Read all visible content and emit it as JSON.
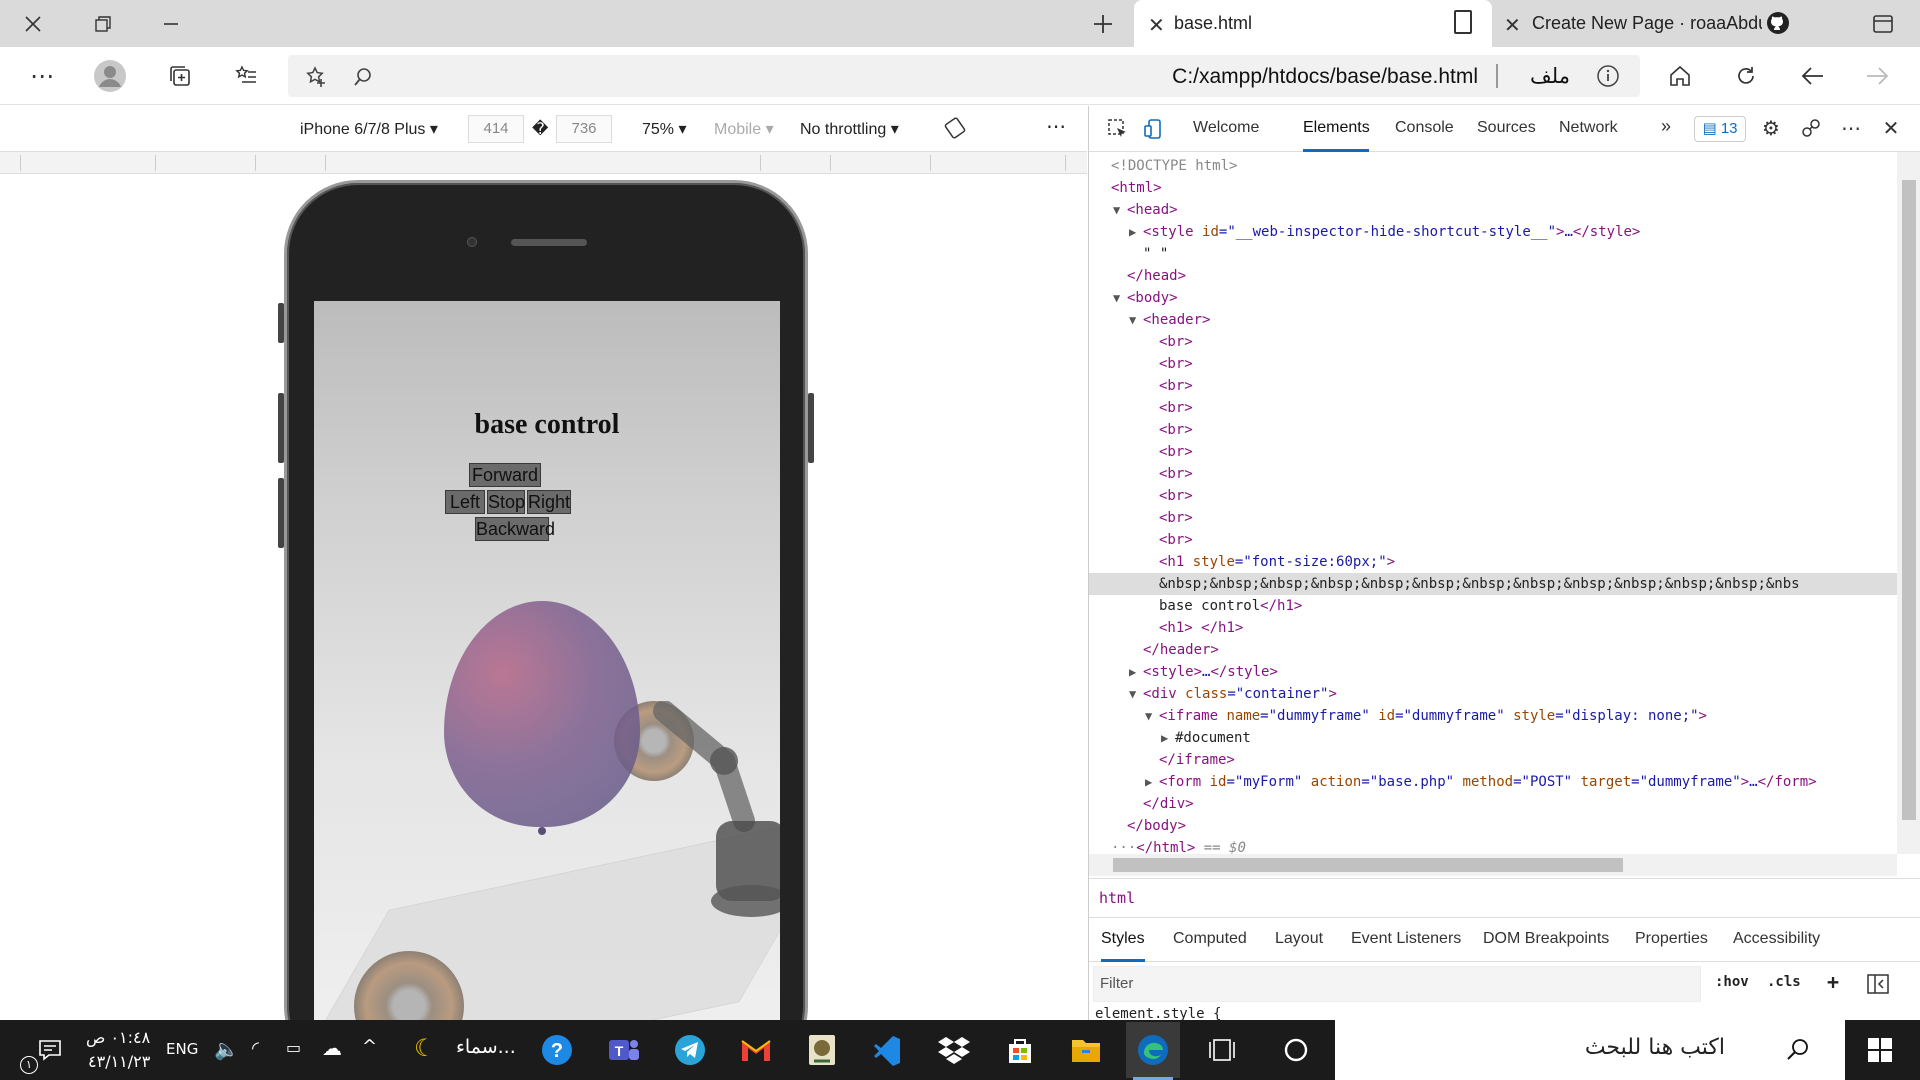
{
  "browser": {
    "tabs": [
      {
        "title": "base.html"
      },
      {
        "title": "Create New Page · roaaAbdullah"
      }
    ],
    "url": "C:/xampp/htdocs/base/base.html",
    "url_prefix": "ملف"
  },
  "device_toolbar": {
    "device": "iPhone 6/7/8 Plus",
    "width": "414",
    "height": "736",
    "separator": "�",
    "zoom": "75%",
    "mode": "Mobile",
    "throttle": "No throttling"
  },
  "page": {
    "title": "base control",
    "buttons": {
      "forward": "Forward",
      "left": "Left",
      "stop": "Stop",
      "right": "Right",
      "backward": "Backward"
    }
  },
  "devtools": {
    "tabs": [
      "Welcome",
      "Elements",
      "Console",
      "Sources",
      "Network"
    ],
    "issues_count": "13",
    "dom": [
      {
        "indent": 0,
        "tri": "",
        "html": "<span class='dm'>&lt;!DOCTYPE html&gt;</span>"
      },
      {
        "indent": 0,
        "tri": "",
        "html": "<span class='tg'>&lt;html&gt;</span>"
      },
      {
        "indent": 1,
        "tri": "▼",
        "html": "<span class='tg'>&lt;head&gt;</span>"
      },
      {
        "indent": 2,
        "tri": "▶",
        "html": "<span class='tg'>&lt;style</span> <span class='at'>id</span>=<span class='av'>\"__web-inspector-hide-shortcut-style__\"</span><span class='tg'>&gt;</span>…<span class='tg'>&lt;/style&gt;</span>"
      },
      {
        "indent": 2,
        "tri": "",
        "html": "<span class='tx'>\" \"</span>"
      },
      {
        "indent": 1,
        "tri": "",
        "html": "<span class='tg'>&lt;/head&gt;</span>"
      },
      {
        "indent": 1,
        "tri": "▼",
        "html": "<span class='tg'>&lt;body&gt;</span>"
      },
      {
        "indent": 2,
        "tri": "▼",
        "html": "<span class='tg'>&lt;header&gt;</span>"
      },
      {
        "indent": 3,
        "tri": "",
        "html": "<span class='tg'>&lt;br&gt;</span>"
      },
      {
        "indent": 3,
        "tri": "",
        "html": "<span class='tg'>&lt;br&gt;</span>"
      },
      {
        "indent": 3,
        "tri": "",
        "html": "<span class='tg'>&lt;br&gt;</span>"
      },
      {
        "indent": 3,
        "tri": "",
        "html": "<span class='tg'>&lt;br&gt;</span>"
      },
      {
        "indent": 3,
        "tri": "",
        "html": "<span class='tg'>&lt;br&gt;</span>"
      },
      {
        "indent": 3,
        "tri": "",
        "html": "<span class='tg'>&lt;br&gt;</span>"
      },
      {
        "indent": 3,
        "tri": "",
        "html": "<span class='tg'>&lt;br&gt;</span>"
      },
      {
        "indent": 3,
        "tri": "",
        "html": "<span class='tg'>&lt;br&gt;</span>"
      },
      {
        "indent": 3,
        "tri": "",
        "html": "<span class='tg'>&lt;br&gt;</span>"
      },
      {
        "indent": 3,
        "tri": "",
        "html": "<span class='tg'>&lt;br&gt;</span>"
      },
      {
        "indent": 3,
        "tri": "",
        "html": "<span class='tg'>&lt;h1</span> <span class='at'>style</span>=<span class='av'>\"font-size:60px;\"</span><span class='tg'>&gt;</span>"
      },
      {
        "indent": 3,
        "tri": "",
        "sel": true,
        "html": "<span class='tx'>&amp;nbsp;&amp;nbsp;&amp;nbsp;&amp;nbsp;&amp;nbsp;&amp;nbsp;&amp;nbsp;&amp;nbsp;&amp;nbsp;&amp;nbsp;&amp;nbsp;&amp;nbsp;&amp;nbs</span>"
      },
      {
        "indent": 3,
        "tri": "",
        "html": "<span class='tx'>base control</span><span class='tg'>&lt;/h1&gt;</span>"
      },
      {
        "indent": 3,
        "tri": "",
        "html": "<span class='tg'>&lt;h1&gt;</span> <span class='tg'>&lt;/h1&gt;</span>"
      },
      {
        "indent": 2,
        "tri": "",
        "html": "<span class='tg'>&lt;/header&gt;</span>"
      },
      {
        "indent": 2,
        "tri": "▶",
        "html": "<span class='tg'>&lt;style&gt;</span>…<span class='tg'>&lt;/style&gt;</span>"
      },
      {
        "indent": 2,
        "tri": "▼",
        "html": "<span class='tg'>&lt;div</span> <span class='at'>class</span>=<span class='av'>\"container\"</span><span class='tg'>&gt;</span>"
      },
      {
        "indent": 3,
        "tri": "▼",
        "html": "<span class='tg'>&lt;iframe</span> <span class='at'>name</span>=<span class='av'>\"dummyframe\"</span> <span class='at'>id</span>=<span class='av'>\"dummyframe\"</span> <span class='at'>style</span>=<span class='av'>\"display: none;\"</span><span class='tg'>&gt;</span>"
      },
      {
        "indent": 4,
        "tri": "▶",
        "html": "<span class='tx'>#document</span>"
      },
      {
        "indent": 3,
        "tri": "",
        "html": "<span class='tg'>&lt;/iframe&gt;</span>"
      },
      {
        "indent": 3,
        "tri": "▶",
        "html": "<span class='tg'>&lt;form</span> <span class='at'>id</span>=<span class='av'>\"myForm\"</span> <span class='at'>action</span>=<span class='av'>\"base.php\"</span> <span class='at'>method</span>=<span class='av'>\"POST\"</span> <span class='at'>target</span>=<span class='av'>\"dummyframe\"</span><span class='tg'>&gt;</span>…<span class='tg'>&lt;/form&gt;</span>"
      },
      {
        "indent": 2,
        "tri": "",
        "html": "<span class='tg'>&lt;/div&gt;</span>"
      },
      {
        "indent": 1,
        "tri": "",
        "html": "<span class='tg'>&lt;/body&gt;</span>"
      },
      {
        "indent": 0,
        "tri": "",
        "html": "<span class='dm'>···</span><span class='tg'>&lt;/html&gt;</span> <span class='dm'><i>== $0</i></span>"
      }
    ],
    "breadcrumb": "html",
    "styles_tabs": [
      "Styles",
      "Computed",
      "Layout",
      "Event Listeners",
      "DOM Breakpoints",
      "Properties",
      "Accessibility"
    ],
    "filter_placeholder": "Filter",
    "hov": ":hov",
    "cls": ".cls",
    "element_style": "element.style {"
  },
  "taskbar": {
    "search_placeholder": "اكتب هنا للبحث",
    "time": "٠١:٤٨ ص",
    "date": "٤٣/١١/٢٣",
    "lang": "ENG",
    "weather_label": "سماء...",
    "notification_count": "١"
  },
  "colors": {
    "accent": "#0f6cbd",
    "taskbar": "#1b1b1b",
    "tabbar": "#dadada"
  }
}
